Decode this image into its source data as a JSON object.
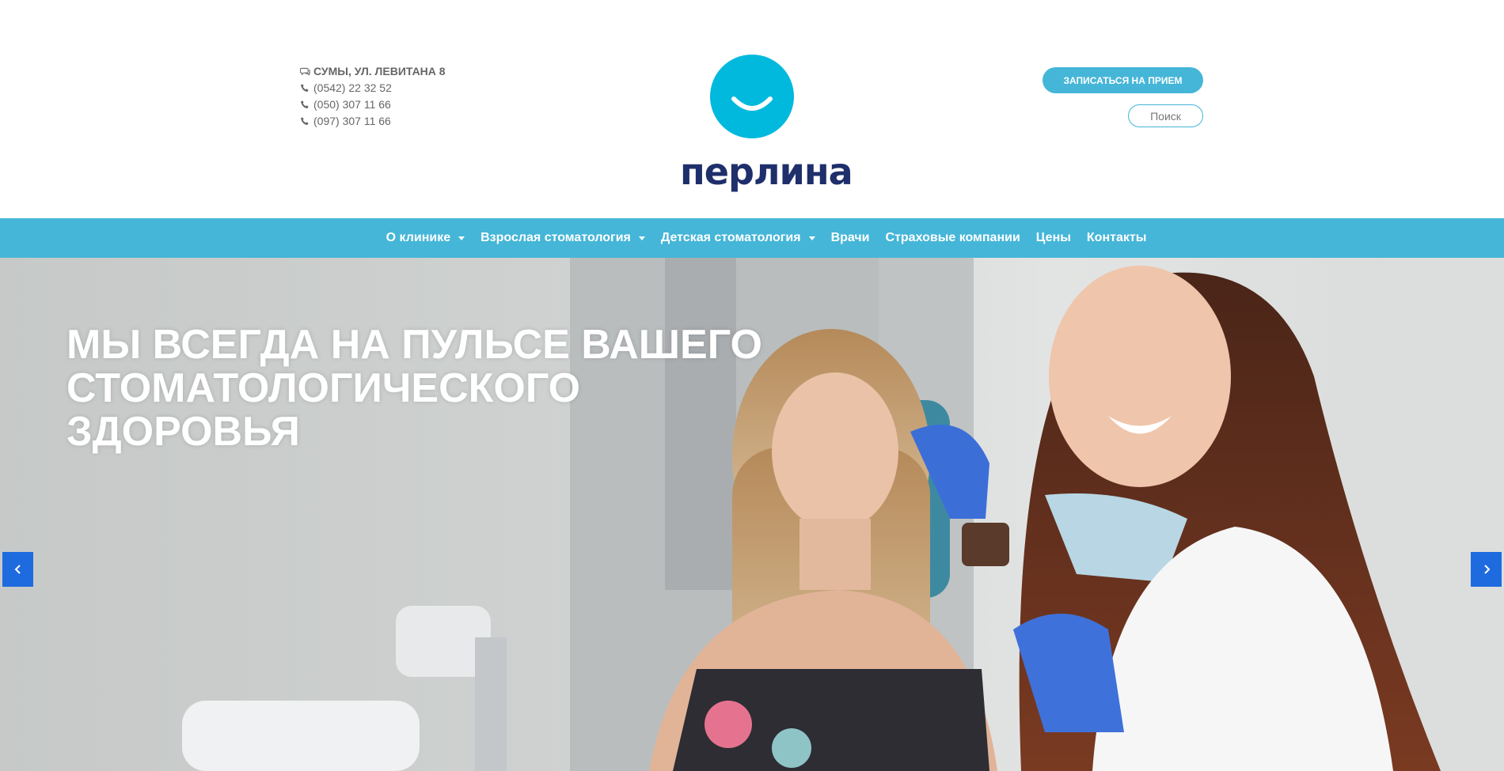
{
  "header": {
    "address": "СУМЫ, УЛ. ЛЕВИТАНА 8",
    "phones": [
      "(0542) 22 32 52",
      "(050) 307 11 66",
      "(097) 307 11 66"
    ],
    "logo_text": "перлина",
    "appointment_label": "ЗАПИСАТЬСЯ НА ПРИЕМ",
    "search_label": "Поиск"
  },
  "nav": {
    "items": [
      {
        "label": "О клинике",
        "has_dropdown": true
      },
      {
        "label": "Взрослая стоматология",
        "has_dropdown": true
      },
      {
        "label": "Детская стоматология",
        "has_dropdown": true
      },
      {
        "label": "Врачи",
        "has_dropdown": false
      },
      {
        "label": "Страховые компании",
        "has_dropdown": false
      },
      {
        "label": "Цены",
        "has_dropdown": false
      },
      {
        "label": "Контакты",
        "has_dropdown": false
      }
    ]
  },
  "hero": {
    "title_lines": [
      "МЫ ВСЕГДА НА ПУЛЬСЕ ВАШЕГО",
      "СТОМАТОЛОГИЧЕСКОГО",
      "ЗДОРОВЬЯ"
    ]
  },
  "colors": {
    "accent": "#45b6d8",
    "logo_circle": "#00b9dd",
    "logo_text": "#1f2f6b",
    "slider_arrow": "#1e6be0"
  },
  "icons": {
    "address": "chat-icon",
    "phone": "phone-icon",
    "prev": "chevron-left-icon",
    "next": "chevron-right-icon"
  }
}
